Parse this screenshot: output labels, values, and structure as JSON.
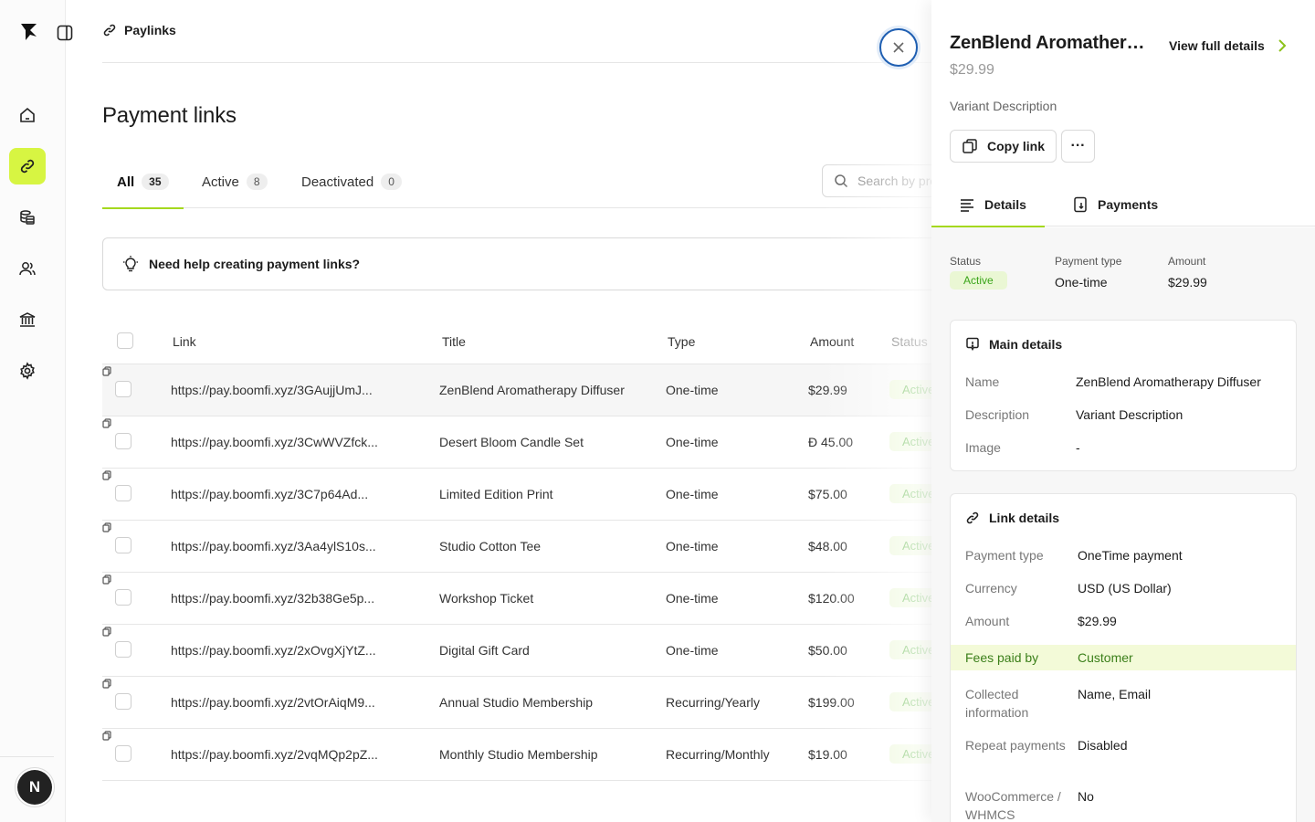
{
  "breadcrumb": {
    "label": "Paylinks"
  },
  "page": {
    "title": "Payment links"
  },
  "tabs": [
    {
      "label": "All",
      "count": "35"
    },
    {
      "label": "Active",
      "count": "8"
    },
    {
      "label": "Deactivated",
      "count": "0"
    }
  ],
  "search": {
    "placeholder": "Search by product"
  },
  "help_banner": {
    "text": "Need help creating payment links?"
  },
  "table": {
    "headers": {
      "link": "Link",
      "title": "Title",
      "type": "Type",
      "amount": "Amount",
      "status": "Status"
    },
    "rows": [
      {
        "link": "https://pay.boomfi.xyz/3GAujjUmJ...",
        "title": "ZenBlend Aromatherapy Diffuser",
        "type": "One-time",
        "amount": "$29.99",
        "status": "Active"
      },
      {
        "link": "https://pay.boomfi.xyz/3CwWVZfck...",
        "title": "Desert Bloom Candle Set",
        "type": "One-time",
        "amount": "Đ 45.00",
        "status": "Active"
      },
      {
        "link": "https://pay.boomfi.xyz/3C7p64Ad...",
        "title": "Limited Edition Print",
        "type": "One-time",
        "amount": "$75.00",
        "status": "Active"
      },
      {
        "link": "https://pay.boomfi.xyz/3Aa4ylS10s...",
        "title": "Studio Cotton Tee",
        "type": "One-time",
        "amount": "$48.00",
        "status": "Active"
      },
      {
        "link": "https://pay.boomfi.xyz/32b38Ge5p...",
        "title": "Workshop Ticket",
        "type": "One-time",
        "amount": "$120.00",
        "status": "Active"
      },
      {
        "link": "https://pay.boomfi.xyz/2xOvgXjYtZ...",
        "title": "Digital Gift Card",
        "type": "One-time",
        "amount": "$50.00",
        "status": "Active"
      },
      {
        "link": "https://pay.boomfi.xyz/2vtOrAiqM9...",
        "title": "Annual Studio Membership",
        "type": "Recurring/Yearly",
        "amount": "$199.00",
        "status": "Active"
      },
      {
        "link": "https://pay.boomfi.xyz/2vqMQp2pZ...",
        "title": "Monthly Studio Membership",
        "type": "Recurring/Monthly",
        "amount": "$19.00",
        "status": "Active"
      }
    ]
  },
  "user": {
    "initial": "N"
  },
  "panel": {
    "title": "ZenBlend Aromathera...",
    "view_full": "View full details",
    "price": "$29.99",
    "variant_description": "Variant Description",
    "copy_link": "Copy link",
    "more": "···",
    "tabs": {
      "details": "Details",
      "payments": "Payments"
    },
    "summary": {
      "status_label": "Status",
      "status_value": "Active",
      "payment_type_label": "Payment type",
      "payment_type_value": "One-time",
      "amount_label": "Amount",
      "amount_value": "$29.99"
    },
    "main_details": {
      "title": "Main details",
      "name_label": "Name",
      "name_value": "ZenBlend Aromatherapy Diffuser",
      "description_label": "Description",
      "description_value": "Variant Description",
      "image_label": "Image",
      "image_value": "-"
    },
    "link_details": {
      "title": "Link details",
      "payment_type_label": "Payment type",
      "payment_type_value": "OneTime payment",
      "currency_label": "Currency",
      "currency_value": "USD (US Dollar)",
      "amount_label": "Amount",
      "amount_value": "$29.99",
      "fees_label": "Fees paid by",
      "fees_value": "Customer",
      "collected_label": "Collected information",
      "collected_value": "Name, Email",
      "repeat_label": "Repeat payments",
      "repeat_value": "Disabled",
      "woo_label": "WooCommerce / WHMCS",
      "woo_value": "No"
    }
  },
  "colors": {
    "accent": "#d7f542",
    "active_green": "#3aa51a",
    "close_ring": "#1f5fb2"
  }
}
